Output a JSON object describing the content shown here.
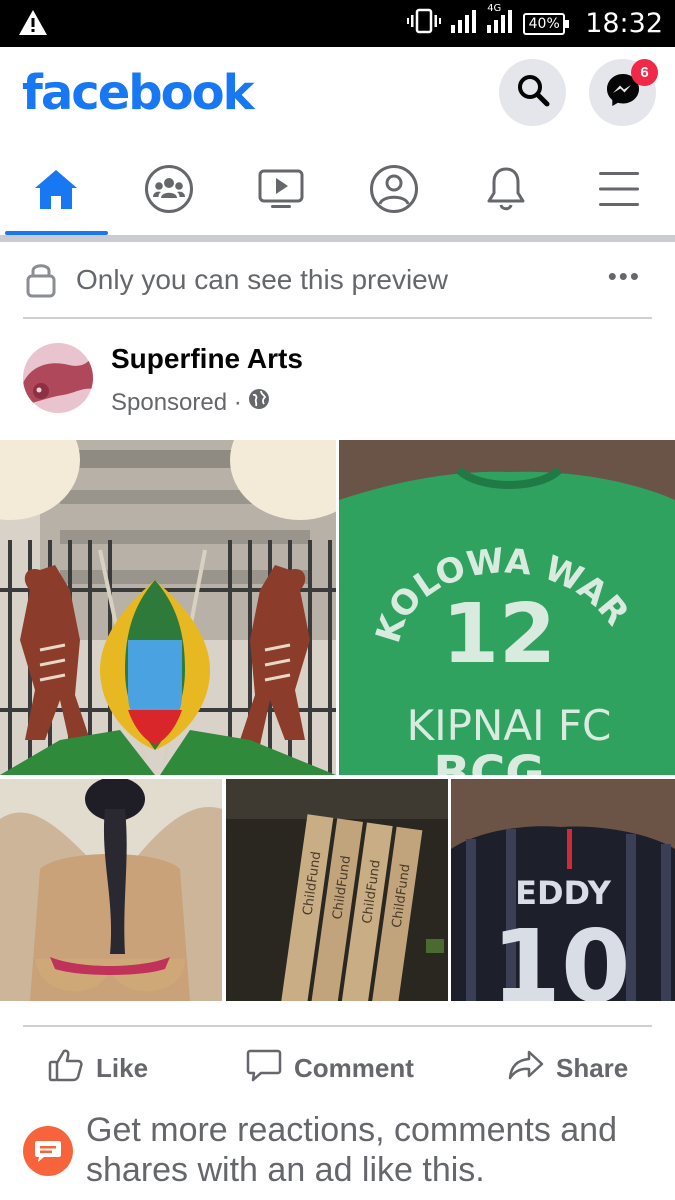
{
  "status_bar": {
    "network": "4G",
    "battery": "40%",
    "time": "18:32"
  },
  "header": {
    "logo": "facebook",
    "messenger_badge": "6"
  },
  "nav": {
    "tabs": [
      {
        "icon": "home-icon",
        "active": true
      },
      {
        "icon": "groups-icon",
        "active": false
      },
      {
        "icon": "watch-icon",
        "active": false
      },
      {
        "icon": "profile-icon",
        "active": false
      },
      {
        "icon": "notifications-bell-icon",
        "active": false
      },
      {
        "icon": "menu-icon",
        "active": false
      }
    ]
  },
  "preview": {
    "text": "Only you can see this preview",
    "more": "•••"
  },
  "post": {
    "page_name": "Superfine Arts",
    "subtitle": "Sponsored ·",
    "photo_texts": {
      "jersey_green": {
        "line1": "KOLOWA WARD",
        "number": "12",
        "line2": "KIPNAI FC",
        "line3": "BCG"
      },
      "planks": {
        "word": "ChildFund"
      },
      "jersey_black": {
        "name": "EDDY",
        "number": "10"
      }
    }
  },
  "actions": {
    "like": "Like",
    "comment": "Comment",
    "share": "Share"
  },
  "promo": {
    "text": "Get more reactions, comments and shares with an ad like this."
  },
  "colors": {
    "brand": "#1877f2",
    "badge": "#f02849",
    "secondary_text": "#65676b",
    "promo_icon": "#f7643b"
  }
}
